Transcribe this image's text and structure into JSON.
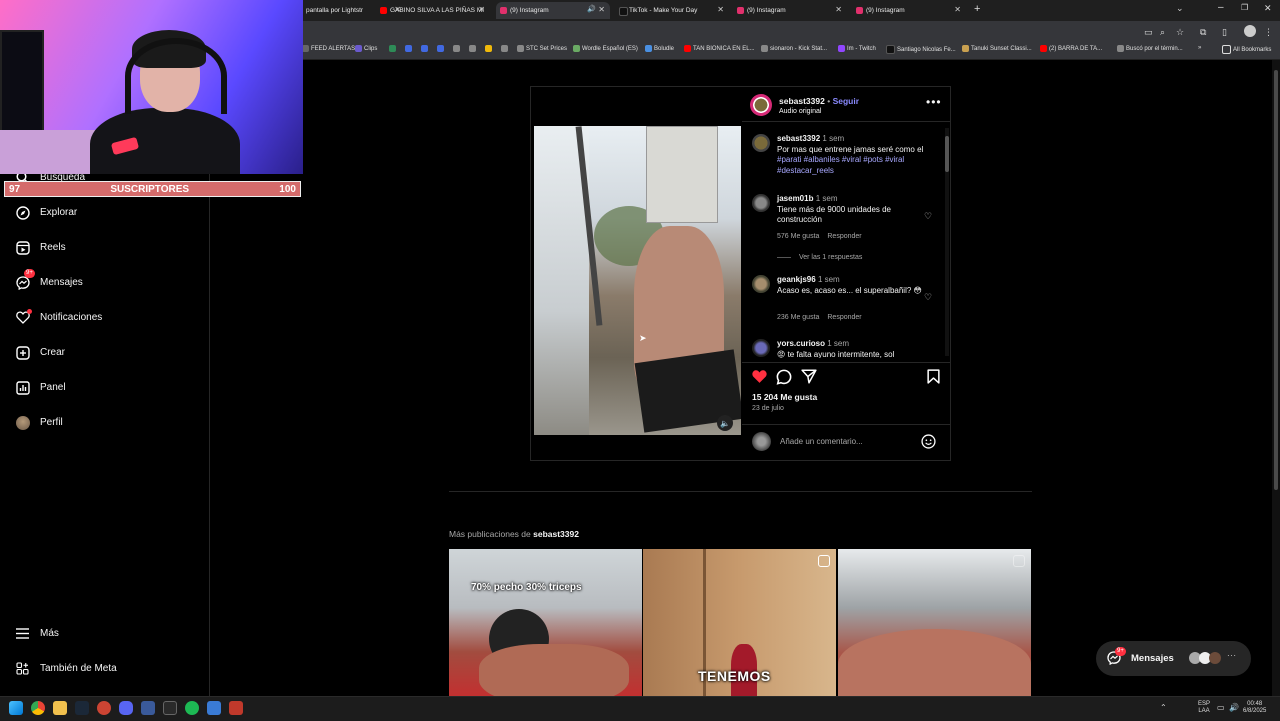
{
  "browser": {
    "tabs": [
      {
        "label": "pantalla por Lightstr",
        "color": "#888888"
      },
      {
        "label": "GABINO SILVA A LAS PIÑAS MI",
        "color": "#ff0000"
      },
      {
        "label": "(9) Instagram",
        "color": "#e1306c"
      },
      {
        "label": "TikTok - Make Your Day",
        "color": "#111111"
      },
      {
        "label": "(9) Instagram",
        "color": "#e1306c"
      },
      {
        "label": "(9) Instagram",
        "color": "#e1306c"
      }
    ],
    "new_tab": "+",
    "bookmarks": [
      {
        "label": "FEED ALERTAS",
        "color": "#666"
      },
      {
        "label": "Clips",
        "color": "#6a5acd"
      },
      {
        "label": "",
        "color": "#2e8b57"
      },
      {
        "label": "",
        "color": "#4169e1"
      },
      {
        "label": "",
        "color": "#4169e1"
      },
      {
        "label": "",
        "color": "#4169e1"
      },
      {
        "label": "",
        "color": "#888"
      },
      {
        "label": "",
        "color": "#f0b90b"
      },
      {
        "label": "STC Set Prices",
        "color": "#888"
      },
      {
        "label": "Wordle Español (ES)",
        "color": "#6aaa64"
      },
      {
        "label": "Boludle",
        "color": "#4a90e2"
      },
      {
        "label": "TAN BIONICA EN EL...",
        "color": "#ff0000"
      },
      {
        "label": "sionaron - Kick Stat...",
        "color": "#888"
      },
      {
        "label": "Im - Twitch",
        "color": "#9146ff"
      },
      {
        "label": "Santiago Nicolas Fe...",
        "color": "#111"
      },
      {
        "label": "Tanuki Sunset Classi...",
        "color": "#c8a050"
      },
      {
        "label": "(2) BARRA DE TA...",
        "color": "#ff0000"
      },
      {
        "label": "Buscó por el términ...",
        "color": "#888"
      },
      {
        "label": "All Bookmarks",
        "color": "#ddd"
      }
    ]
  },
  "overlay": {
    "sub_left": "97",
    "sub_title": "SUSCRIPTORES",
    "sub_right": "100"
  },
  "sidebar": {
    "items": [
      {
        "label": "Búsqueda",
        "icon": "search-icon"
      },
      {
        "label": "Explorar",
        "icon": "compass-icon"
      },
      {
        "label": "Reels",
        "icon": "reels-icon"
      },
      {
        "label": "Mensajes",
        "icon": "messenger-icon",
        "badge": "9+"
      },
      {
        "label": "Notificaciones",
        "icon": "heart-icon"
      },
      {
        "label": "Crear",
        "icon": "plus-icon"
      },
      {
        "label": "Panel",
        "icon": "chart-icon"
      },
      {
        "label": "Perfil",
        "icon": "avatar"
      }
    ],
    "more": "Más",
    "meta": "También de Meta"
  },
  "post": {
    "username": "sebast3392",
    "separator": "•",
    "follow": "Seguir",
    "audio": "Audio original",
    "caption": {
      "user": "sebast3392",
      "time": "1 sem",
      "text": "Por mas que entrene jamas seré como el",
      "tags": "#parati #albaniles #viral #pots #viral #destacar_reels"
    },
    "comments": [
      {
        "user": "jasem01b",
        "time": "1 sem",
        "text": "Tiene más de 9000 unidades de construcción",
        "likes": "576 Me gusta",
        "reply": "Responder",
        "view_replies": "Ver las 1 respuestas"
      },
      {
        "user": "geankjs96",
        "time": "1 sem",
        "text": "Acaso es, acaso es... el superalbañil? 😳",
        "likes": "236 Me gusta",
        "reply": "Responder"
      },
      {
        "user": "yors.curioso",
        "time": "1 sem",
        "text": "😡 te falta ayuno intermitente, sol"
      }
    ],
    "likes": "15 204 Me gusta",
    "date": "23 de julio",
    "add_comment_placeholder": "Añade un comentario..."
  },
  "more_posts": {
    "label": "Más publicaciones de",
    "user": "sebast3392",
    "captions": [
      "70% pecho  30% triceps",
      "TENEMOS",
      ""
    ]
  },
  "messages_pill": {
    "label": "Mensajes",
    "badge": "9+"
  },
  "taskbar": {
    "lang_top": "ESP",
    "lang_bottom": "LAA",
    "time": "00:48",
    "date": "6/8/2025"
  }
}
